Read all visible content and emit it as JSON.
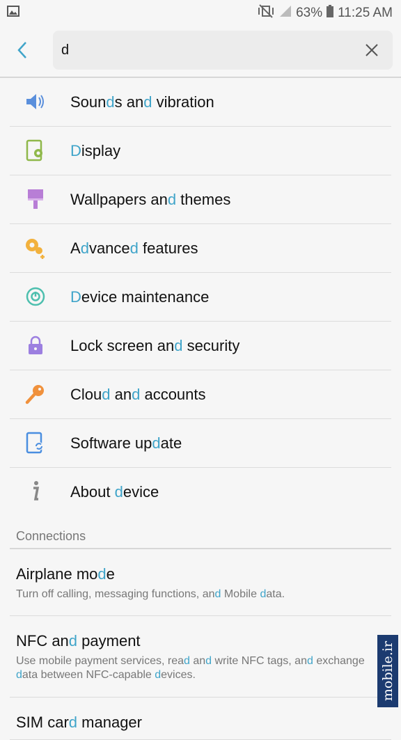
{
  "status_bar": {
    "battery": "63%",
    "time": "11:25 AM",
    "icons": [
      "image-icon",
      "mute-vibrate-icon",
      "signal-icon",
      "battery-icon"
    ]
  },
  "search": {
    "query": "d",
    "back_icon": "back-arrow-icon",
    "clear_icon": "close-icon"
  },
  "results": [
    {
      "icon": "speaker-icon",
      "parts": [
        "Soun",
        "d",
        "s an",
        "d",
        " vibration"
      ]
    },
    {
      "icon": "display-gear-icon",
      "parts": [
        "",
        "D",
        "isplay"
      ]
    },
    {
      "icon": "paint-roller-icon",
      "parts": [
        "Wallpapers an",
        "d",
        " themes"
      ]
    },
    {
      "icon": "gears-plus-icon",
      "parts": [
        "A",
        "d",
        "vance",
        "d",
        " features"
      ]
    },
    {
      "icon": "device-maintenance-icon",
      "parts": [
        "",
        "D",
        "evice maintenance"
      ]
    },
    {
      "icon": "lock-icon",
      "parts": [
        "Lock screen an",
        "d",
        " security"
      ]
    },
    {
      "icon": "key-icon",
      "parts": [
        "Clou",
        "d",
        " an",
        "d",
        " accounts"
      ]
    },
    {
      "icon": "software-update-icon",
      "parts": [
        "Software up",
        "d",
        "ate"
      ]
    },
    {
      "icon": "info-icon",
      "parts": [
        "About ",
        "d",
        "evice"
      ]
    }
  ],
  "connections": {
    "header": "Connections",
    "items": [
      {
        "title": [
          "Airplane mo",
          "d",
          "e"
        ],
        "desc": [
          "Turn off calling, messaging functions, an",
          "d",
          " Mobile ",
          "d",
          "ata."
        ]
      },
      {
        "title": [
          "NFC an",
          "d",
          " payment"
        ],
        "desc": [
          "Use mobile payment services, rea",
          "d",
          " an",
          "d",
          " write NFC tags, an",
          "d",
          " exchange ",
          "d",
          "ata between NFC-capable ",
          "d",
          "evices."
        ]
      },
      {
        "title": [
          "SIM car",
          "d",
          " manager"
        ],
        "desc": []
      }
    ]
  },
  "watermark": "mobile.ir",
  "colors": {
    "highlight": "#3fa4c9",
    "background": "#f6f6f6"
  }
}
